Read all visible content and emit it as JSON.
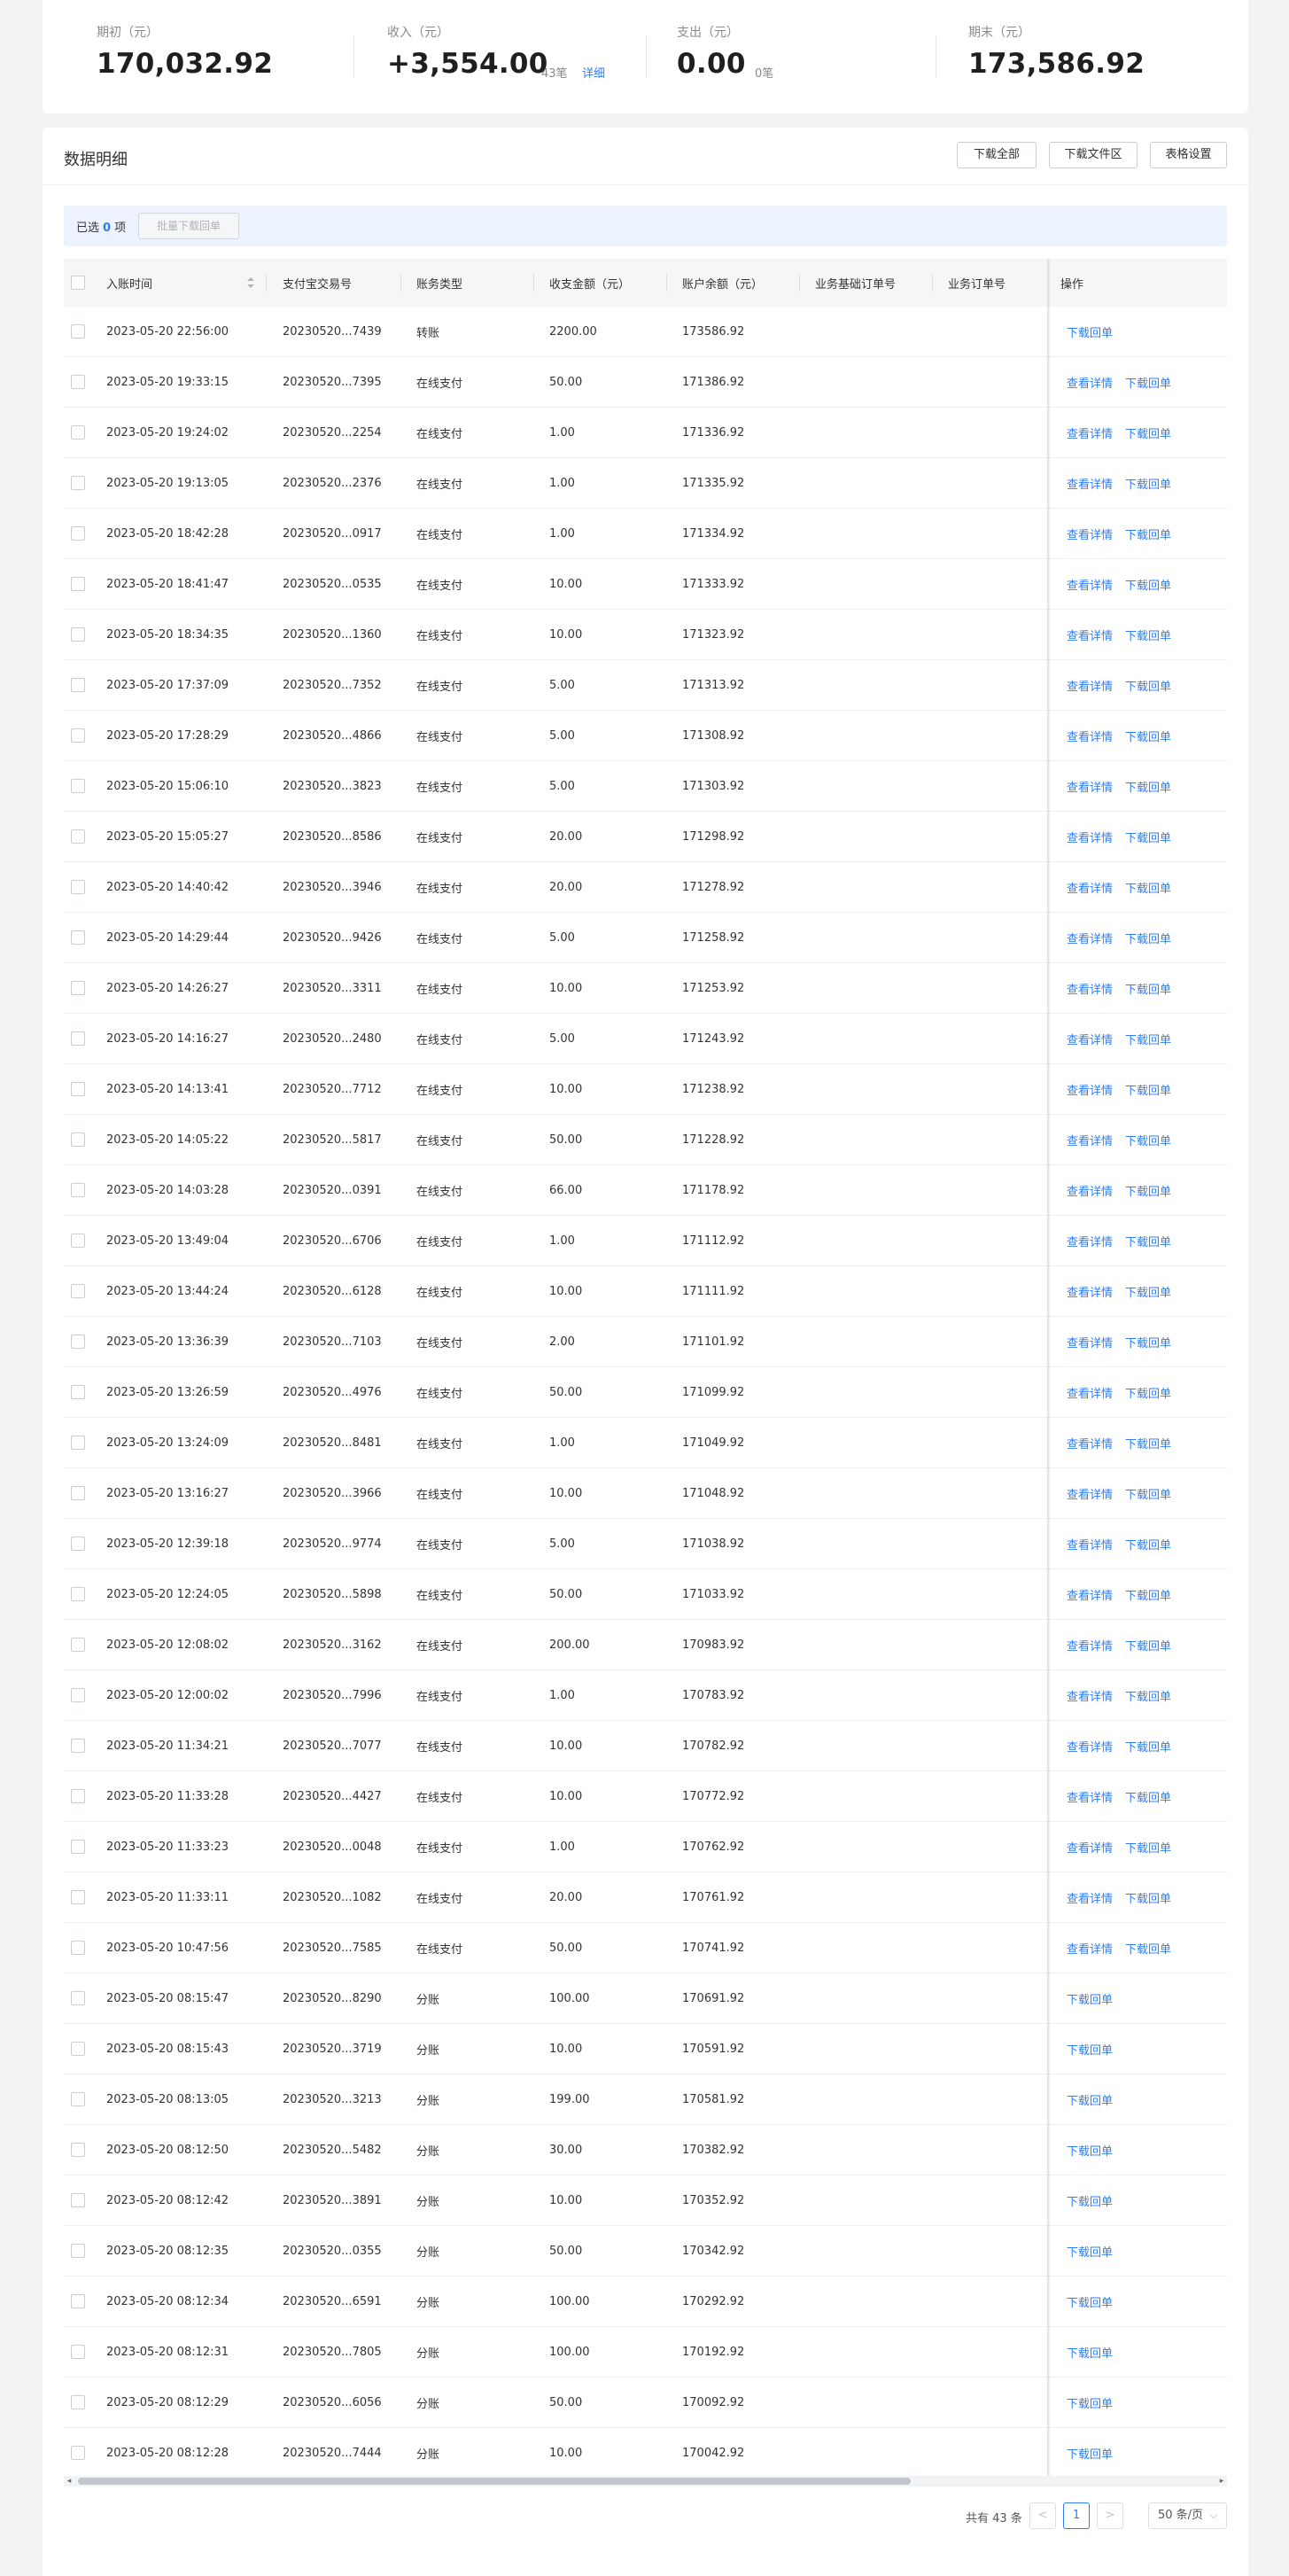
{
  "summary": [
    {
      "label": "期初（元）",
      "value": "170,032.92"
    },
    {
      "label": "收入（元）",
      "value": "+3,554.00",
      "count": "43笔",
      "link": "详细"
    },
    {
      "label": "支出（元）",
      "value": "0.00",
      "count": "0笔"
    },
    {
      "label": "期末（元）",
      "value": "173,586.92"
    }
  ],
  "panel": {
    "title": "数据明细",
    "download_all": "下载全部",
    "download_file_area": "下载文件区",
    "table_settings": "表格设置"
  },
  "selection": {
    "prefix": "已选",
    "count": "0",
    "suffix": "项",
    "batch_button": "批量下载回单"
  },
  "table": {
    "columns": [
      "入账时间",
      "支付宝交易号",
      "账务类型",
      "收支金额（元）",
      "账户余额（元）",
      "业务基础订单号",
      "业务订单号",
      "操作"
    ],
    "actions": {
      "view": "查看详情",
      "download": "下载回单"
    },
    "rows": [
      {
        "time": "2023-05-20 22:56:00",
        "txn": "20230520...7439",
        "type": "转账",
        "amount": "2200.00",
        "balance": "173586.92",
        "view": false
      },
      {
        "time": "2023-05-20 19:33:15",
        "txn": "20230520...7395",
        "type": "在线支付",
        "amount": "50.00",
        "balance": "171386.92",
        "view": true
      },
      {
        "time": "2023-05-20 19:24:02",
        "txn": "20230520...2254",
        "type": "在线支付",
        "amount": "1.00",
        "balance": "171336.92",
        "view": true
      },
      {
        "time": "2023-05-20 19:13:05",
        "txn": "20230520...2376",
        "type": "在线支付",
        "amount": "1.00",
        "balance": "171335.92",
        "view": true
      },
      {
        "time": "2023-05-20 18:42:28",
        "txn": "20230520...0917",
        "type": "在线支付",
        "amount": "1.00",
        "balance": "171334.92",
        "view": true
      },
      {
        "time": "2023-05-20 18:41:47",
        "txn": "20230520...0535",
        "type": "在线支付",
        "amount": "10.00",
        "balance": "171333.92",
        "view": true
      },
      {
        "time": "2023-05-20 18:34:35",
        "txn": "20230520...1360",
        "type": "在线支付",
        "amount": "10.00",
        "balance": "171323.92",
        "view": true
      },
      {
        "time": "2023-05-20 17:37:09",
        "txn": "20230520...7352",
        "type": "在线支付",
        "amount": "5.00",
        "balance": "171313.92",
        "view": true
      },
      {
        "time": "2023-05-20 17:28:29",
        "txn": "20230520...4866",
        "type": "在线支付",
        "amount": "5.00",
        "balance": "171308.92",
        "view": true
      },
      {
        "time": "2023-05-20 15:06:10",
        "txn": "20230520...3823",
        "type": "在线支付",
        "amount": "5.00",
        "balance": "171303.92",
        "view": true
      },
      {
        "time": "2023-05-20 15:05:27",
        "txn": "20230520...8586",
        "type": "在线支付",
        "amount": "20.00",
        "balance": "171298.92",
        "view": true
      },
      {
        "time": "2023-05-20 14:40:42",
        "txn": "20230520...3946",
        "type": "在线支付",
        "amount": "20.00",
        "balance": "171278.92",
        "view": true
      },
      {
        "time": "2023-05-20 14:29:44",
        "txn": "20230520...9426",
        "type": "在线支付",
        "amount": "5.00",
        "balance": "171258.92",
        "view": true
      },
      {
        "time": "2023-05-20 14:26:27",
        "txn": "20230520...3311",
        "type": "在线支付",
        "amount": "10.00",
        "balance": "171253.92",
        "view": true
      },
      {
        "time": "2023-05-20 14:16:27",
        "txn": "20230520...2480",
        "type": "在线支付",
        "amount": "5.00",
        "balance": "171243.92",
        "view": true
      },
      {
        "time": "2023-05-20 14:13:41",
        "txn": "20230520...7712",
        "type": "在线支付",
        "amount": "10.00",
        "balance": "171238.92",
        "view": true
      },
      {
        "time": "2023-05-20 14:05:22",
        "txn": "20230520...5817",
        "type": "在线支付",
        "amount": "50.00",
        "balance": "171228.92",
        "view": true
      },
      {
        "time": "2023-05-20 14:03:28",
        "txn": "20230520...0391",
        "type": "在线支付",
        "amount": "66.00",
        "balance": "171178.92",
        "view": true
      },
      {
        "time": "2023-05-20 13:49:04",
        "txn": "20230520...6706",
        "type": "在线支付",
        "amount": "1.00",
        "balance": "171112.92",
        "view": true
      },
      {
        "time": "2023-05-20 13:44:24",
        "txn": "20230520...6128",
        "type": "在线支付",
        "amount": "10.00",
        "balance": "171111.92",
        "view": true
      },
      {
        "time": "2023-05-20 13:36:39",
        "txn": "20230520...7103",
        "type": "在线支付",
        "amount": "2.00",
        "balance": "171101.92",
        "view": true
      },
      {
        "time": "2023-05-20 13:26:59",
        "txn": "20230520...4976",
        "type": "在线支付",
        "amount": "50.00",
        "balance": "171099.92",
        "view": true
      },
      {
        "time": "2023-05-20 13:24:09",
        "txn": "20230520...8481",
        "type": "在线支付",
        "amount": "1.00",
        "balance": "171049.92",
        "view": true
      },
      {
        "time": "2023-05-20 13:16:27",
        "txn": "20230520...3966",
        "type": "在线支付",
        "amount": "10.00",
        "balance": "171048.92",
        "view": true
      },
      {
        "time": "2023-05-20 12:39:18",
        "txn": "20230520...9774",
        "type": "在线支付",
        "amount": "5.00",
        "balance": "171038.92",
        "view": true
      },
      {
        "time": "2023-05-20 12:24:05",
        "txn": "20230520...5898",
        "type": "在线支付",
        "amount": "50.00",
        "balance": "171033.92",
        "view": true
      },
      {
        "time": "2023-05-20 12:08:02",
        "txn": "20230520...3162",
        "type": "在线支付",
        "amount": "200.00",
        "balance": "170983.92",
        "view": true
      },
      {
        "time": "2023-05-20 12:00:02",
        "txn": "20230520...7996",
        "type": "在线支付",
        "amount": "1.00",
        "balance": "170783.92",
        "view": true
      },
      {
        "time": "2023-05-20 11:34:21",
        "txn": "20230520...7077",
        "type": "在线支付",
        "amount": "10.00",
        "balance": "170782.92",
        "view": true
      },
      {
        "time": "2023-05-20 11:33:28",
        "txn": "20230520...4427",
        "type": "在线支付",
        "amount": "10.00",
        "balance": "170772.92",
        "view": true
      },
      {
        "time": "2023-05-20 11:33:23",
        "txn": "20230520...0048",
        "type": "在线支付",
        "amount": "1.00",
        "balance": "170762.92",
        "view": true
      },
      {
        "time": "2023-05-20 11:33:11",
        "txn": "20230520...1082",
        "type": "在线支付",
        "amount": "20.00",
        "balance": "170761.92",
        "view": true
      },
      {
        "time": "2023-05-20 10:47:56",
        "txn": "20230520...7585",
        "type": "在线支付",
        "amount": "50.00",
        "balance": "170741.92",
        "view": true
      },
      {
        "time": "2023-05-20 08:15:47",
        "txn": "20230520...8290",
        "type": "分账",
        "amount": "100.00",
        "balance": "170691.92",
        "view": false
      },
      {
        "time": "2023-05-20 08:15:43",
        "txn": "20230520...3719",
        "type": "分账",
        "amount": "10.00",
        "balance": "170591.92",
        "view": false
      },
      {
        "time": "2023-05-20 08:13:05",
        "txn": "20230520...3213",
        "type": "分账",
        "amount": "199.00",
        "balance": "170581.92",
        "view": false
      },
      {
        "time": "2023-05-20 08:12:50",
        "txn": "20230520...5482",
        "type": "分账",
        "amount": "30.00",
        "balance": "170382.92",
        "view": false
      },
      {
        "time": "2023-05-20 08:12:42",
        "txn": "20230520...3891",
        "type": "分账",
        "amount": "10.00",
        "balance": "170352.92",
        "view": false
      },
      {
        "time": "2023-05-20 08:12:35",
        "txn": "20230520...0355",
        "type": "分账",
        "amount": "50.00",
        "balance": "170342.92",
        "view": false
      },
      {
        "time": "2023-05-20 08:12:34",
        "txn": "20230520...6591",
        "type": "分账",
        "amount": "100.00",
        "balance": "170292.92",
        "view": false
      },
      {
        "time": "2023-05-20 08:12:31",
        "txn": "20230520...7805",
        "type": "分账",
        "amount": "100.00",
        "balance": "170192.92",
        "view": false
      },
      {
        "time": "2023-05-20 08:12:29",
        "txn": "20230520...6056",
        "type": "分账",
        "amount": "50.00",
        "balance": "170092.92",
        "view": false
      },
      {
        "time": "2023-05-20 08:12:28",
        "txn": "20230520...7444",
        "type": "分账",
        "amount": "10.00",
        "balance": "170042.92",
        "view": false
      }
    ]
  },
  "pagination": {
    "total": "共有 43 条",
    "prev": "<",
    "current": "1",
    "next": ">",
    "page_size": "50 条/页",
    "size_chevron": "⌵"
  },
  "scrollbar": {
    "left_arrow": "◂",
    "right_arrow": "▸"
  },
  "colors": {
    "accent": "#2f7df6",
    "background": "#f2f3f5",
    "header": "#f5f6f8",
    "select_bar": "#edf3fe"
  }
}
